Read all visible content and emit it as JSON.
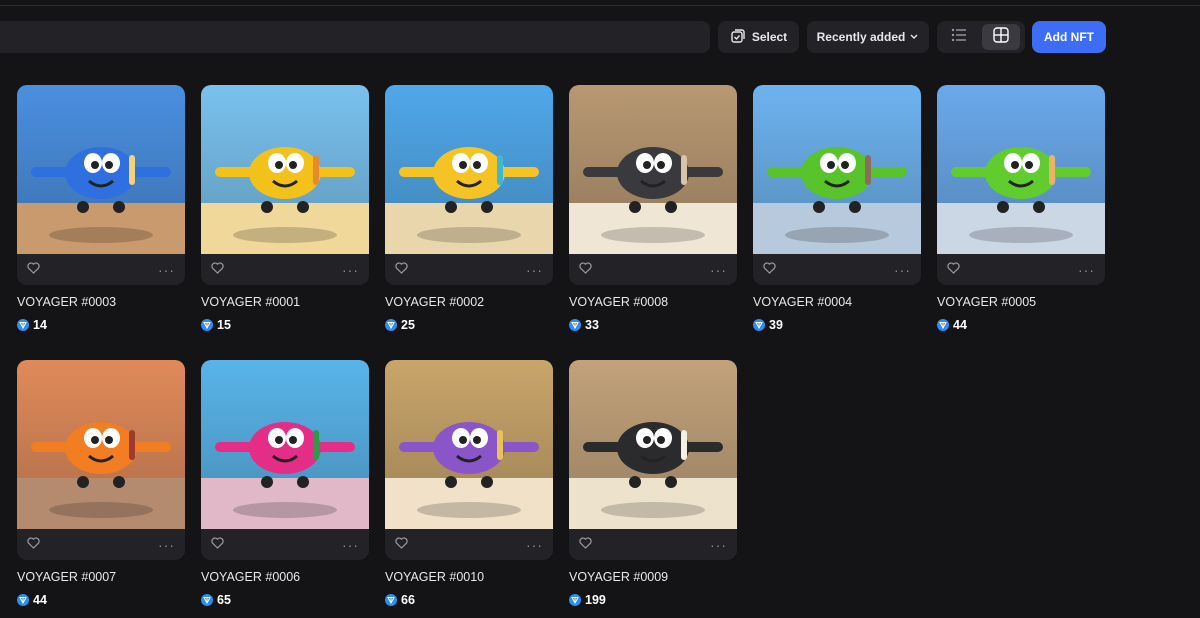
{
  "toolbar": {
    "select_label": "Select",
    "sort_label": "Recently added",
    "add_label": "Add NFT",
    "view_mode": "grid"
  },
  "colors": {
    "background": "#141416",
    "surface": "#232327",
    "accent": "#3d6cf5",
    "coin": "#2f8dee"
  },
  "nfts": [
    {
      "name": "VOYAGER #0003",
      "price": "14"
    },
    {
      "name": "VOYAGER #0001",
      "price": "15"
    },
    {
      "name": "VOYAGER #0002",
      "price": "25"
    },
    {
      "name": "VOYAGER #0008",
      "price": "33"
    },
    {
      "name": "VOYAGER #0004",
      "price": "39"
    },
    {
      "name": "VOYAGER #0005",
      "price": "44"
    },
    {
      "name": "VOYAGER #0007",
      "price": "44"
    },
    {
      "name": "VOYAGER #0006",
      "price": "65"
    },
    {
      "name": "VOYAGER #0010",
      "price": "66"
    },
    {
      "name": "VOYAGER #0009",
      "price": "199"
    }
  ]
}
